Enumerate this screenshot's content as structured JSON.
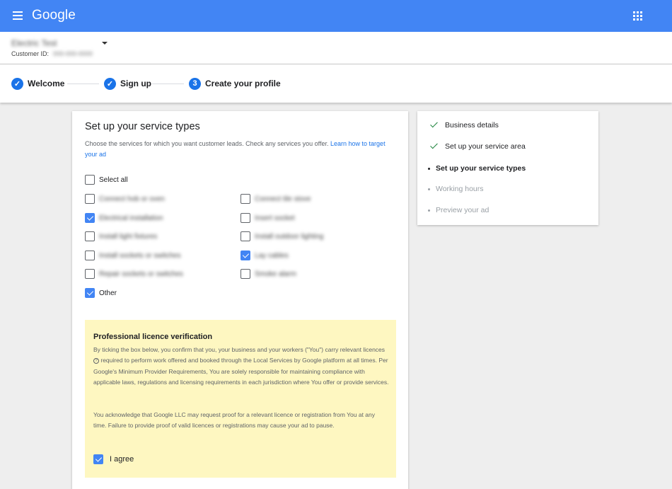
{
  "header": {
    "logo": "Google",
    "menu_icon": "hamburger-menu-icon",
    "apps_icon": "apps-grid-icon",
    "color": "#4285f4"
  },
  "account": {
    "name": "Electric Test",
    "customer_id_label": "Customer ID:",
    "customer_id": "000-000-0000"
  },
  "stepper": {
    "steps": [
      {
        "label": "Welcome",
        "marker": "✓",
        "state": "done"
      },
      {
        "label": "Sign up",
        "marker": "✓",
        "state": "done"
      },
      {
        "label": "Create your profile",
        "marker": "3",
        "state": "current"
      }
    ]
  },
  "main": {
    "title": "Set up your service types",
    "description": "Choose the services for which you want customer leads. Check any services you offer.",
    "learn_link": "Learn how to target your ad",
    "select_all": {
      "label": "Select all",
      "checked": false
    },
    "services_left": [
      {
        "label": "Connect hob or oven",
        "checked": false
      },
      {
        "label": "Electrical installation",
        "checked": true
      },
      {
        "label": "Install light fixtures",
        "checked": false
      },
      {
        "label": "Install sockets or switches",
        "checked": false
      },
      {
        "label": "Repair sockets or switches",
        "checked": false
      }
    ],
    "services_right": [
      {
        "label": "Connect tile stove",
        "checked": false
      },
      {
        "label": "Insert socket",
        "checked": false
      },
      {
        "label": "Install outdoor lighting",
        "checked": false
      },
      {
        "label": "Lay cables",
        "checked": true
      },
      {
        "label": "Smoke alarm",
        "checked": false
      }
    ],
    "other": {
      "label": "Other",
      "checked": true
    }
  },
  "licence": {
    "title": "Professional licence verification",
    "p1_before": "By ticking the box below, you confirm that you, your business and your workers (\"You\") carry relevant licences",
    "p1_after": "required to perform work offered and booked through the Local Services by Google platform at all times. Per Google's Minimum Provider Requirements, You are solely responsible for maintaining compliance with applicable laws, regulations and licensing requirements in each jurisdiction where You offer or provide services.",
    "p2": "You acknowledge that Google LLC may request proof for a relevant licence or registration from You at any time. Failure to provide proof of valid licences or registrations may cause your ad to pause.",
    "help_glyph": "?",
    "agree_label": "I agree",
    "agree_checked": true,
    "background": "#fef7c1"
  },
  "sidebar": {
    "items": [
      {
        "label": "Business details",
        "state": "done"
      },
      {
        "label": "Set up your service area",
        "state": "done"
      },
      {
        "label": "Set up your service types",
        "state": "current"
      },
      {
        "label": "Working hours",
        "state": "pending"
      },
      {
        "label": "Preview your ad",
        "state": "pending"
      }
    ],
    "colors": {
      "done_check": "#188038",
      "current": "#202124",
      "pending": "#9aa0a6"
    }
  }
}
